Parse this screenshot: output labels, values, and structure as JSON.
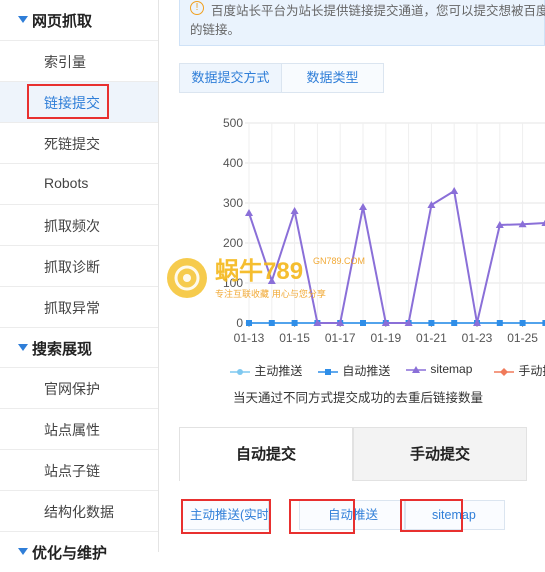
{
  "sidebar": {
    "sections": [
      {
        "title": "网页抓取",
        "items": [
          "索引量",
          "链接提交",
          "死链提交",
          "Robots",
          "抓取频次",
          "抓取诊断",
          "抓取异常"
        ]
      },
      {
        "title": "搜索展现",
        "items": [
          "官网保护",
          "站点属性",
          "站点子链",
          "结构化数据"
        ]
      },
      {
        "title": "优化与维护",
        "items": []
      }
    ],
    "active_item": "链接提交"
  },
  "notice": {
    "line1": "百度站长平台为站长提供链接提交通道，您可以提交想被百度收",
    "line2": "的链接。"
  },
  "chart_tabs": [
    "数据提交方式",
    "数据类型"
  ],
  "chart_data": {
    "type": "line",
    "y_ticks": [
      "500",
      "400",
      "300",
      "200",
      "100",
      "0"
    ],
    "ylim": [
      0,
      500
    ],
    "x_tick_labels": [
      "01-13",
      "01-15",
      "01-17",
      "01-19",
      "01-21",
      "01-23",
      "01-25"
    ],
    "x": [
      "01-13",
      "01-14",
      "01-15",
      "01-16",
      "01-17",
      "01-18",
      "01-19",
      "01-20",
      "01-21",
      "01-22",
      "01-23",
      "01-24",
      "01-25",
      "01-26"
    ],
    "series": [
      {
        "name": "主动推送",
        "color": "#7ec8f0",
        "values": [
          0,
          0,
          0,
          0,
          0,
          0,
          0,
          0,
          0,
          0,
          0,
          0,
          0,
          0
        ]
      },
      {
        "name": "自动推送",
        "color": "#2f8ee8",
        "values": [
          0,
          0,
          0,
          0,
          0,
          0,
          0,
          0,
          0,
          0,
          0,
          0,
          0,
          0
        ]
      },
      {
        "name": "sitemap",
        "color": "#8a6fd8",
        "values": [
          275,
          105,
          280,
          0,
          0,
          290,
          0,
          0,
          295,
          330,
          0,
          245,
          247,
          250
        ]
      },
      {
        "name": "手动提交",
        "color": "#f07a5a",
        "values": []
      }
    ]
  },
  "caption": "当天通过不同方式提交成功的去重后链接数量",
  "submit_tabs": [
    "自动提交",
    "手动提交"
  ],
  "sub_tabs": [
    "主动推送(实时)",
    "自动推送",
    "sitemap"
  ],
  "watermark": {
    "brand": "蜗牛789",
    "domain": "GN789.COM",
    "slogan": "专注互联收藏 用心与您分享"
  },
  "colors": {
    "accent": "#2f7ed8",
    "highlight": "#e8302f"
  }
}
